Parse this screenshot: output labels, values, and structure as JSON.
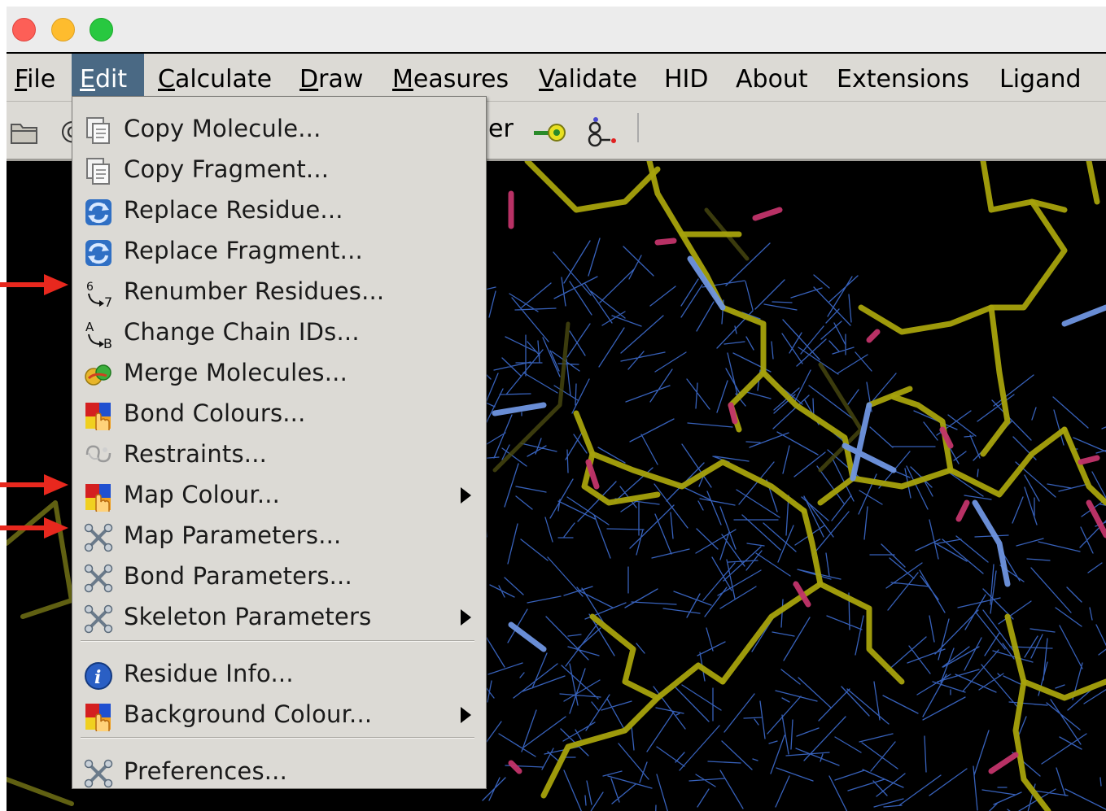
{
  "menubar": {
    "items": [
      {
        "pre": "",
        "u": "F",
        "post": "ile"
      },
      {
        "pre": "",
        "u": "E",
        "post": "dit"
      },
      {
        "pre": "",
        "u": "C",
        "post": "alculate"
      },
      {
        "pre": "",
        "u": "D",
        "post": "raw"
      },
      {
        "pre": "",
        "u": "M",
        "post": "easures"
      },
      {
        "pre": "",
        "u": "V",
        "post": "alidate"
      },
      {
        "pre": "HID",
        "u": "",
        "post": ""
      },
      {
        "pre": "About",
        "u": "",
        "post": ""
      },
      {
        "pre": "Extensions",
        "u": "",
        "post": ""
      },
      {
        "pre": "Ligand",
        "u": "",
        "post": ""
      }
    ]
  },
  "toolbar": {
    "partial_text": "er",
    "icons": [
      "folder-icon",
      "ligand-key-icon",
      "molecule-icon"
    ]
  },
  "edit_menu": {
    "items": [
      {
        "label": "Copy Molecule...",
        "icon": "copy-icon"
      },
      {
        "label": "Copy Fragment...",
        "icon": "copy-icon"
      },
      {
        "label": "Replace Residue...",
        "icon": "refresh-icon"
      },
      {
        "label": "Replace Fragment...",
        "icon": "refresh-icon"
      },
      {
        "label": "Renumber Residues...",
        "icon": "renumber-icon"
      },
      {
        "label": "Change Chain IDs...",
        "icon": "chain-id-icon"
      },
      {
        "label": "Merge Molecules...",
        "icon": "merge-icon"
      },
      {
        "label": "Bond Colours...",
        "icon": "colour-hand-icon"
      },
      {
        "label": "Restraints...",
        "icon": "restraints-icon"
      },
      {
        "label": "Map Colour...",
        "icon": "colour-hand-icon",
        "submenu": true
      },
      {
        "label": "Map Parameters...",
        "icon": "tools-icon"
      },
      {
        "label": "Bond Parameters...",
        "icon": "tools-icon"
      },
      {
        "label": "Skeleton Parameters",
        "icon": "tools-icon",
        "submenu": true
      },
      {
        "label": "Residue Info...",
        "icon": "info-icon"
      },
      {
        "label": "Background Colour...",
        "icon": "colour-hand-icon",
        "submenu": true
      },
      {
        "label": "Preferences...",
        "icon": "tools-icon"
      }
    ]
  },
  "colors": {
    "annotation_arrow": "#e8281e",
    "menu_highlight": "#4a6984",
    "map_mesh": "#3a66c4",
    "carbon_bond": "#a7a20c"
  }
}
